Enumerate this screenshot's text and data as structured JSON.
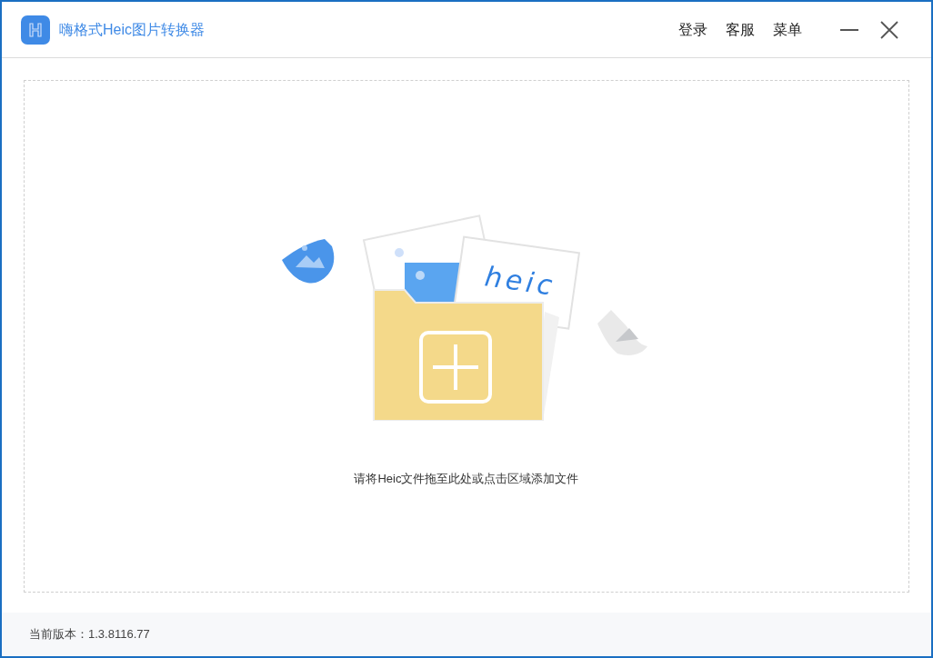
{
  "window": {
    "title": "嗨格式Heic图片转换器"
  },
  "header_links": [
    "登录",
    "客服",
    "菜单"
  ],
  "drop_zone": {
    "card_text": "heic",
    "hint": "请将Heic文件拖至此处或点击区域添加文件"
  },
  "status_bar": {
    "version": "当前版本：1.3.8116.77"
  }
}
